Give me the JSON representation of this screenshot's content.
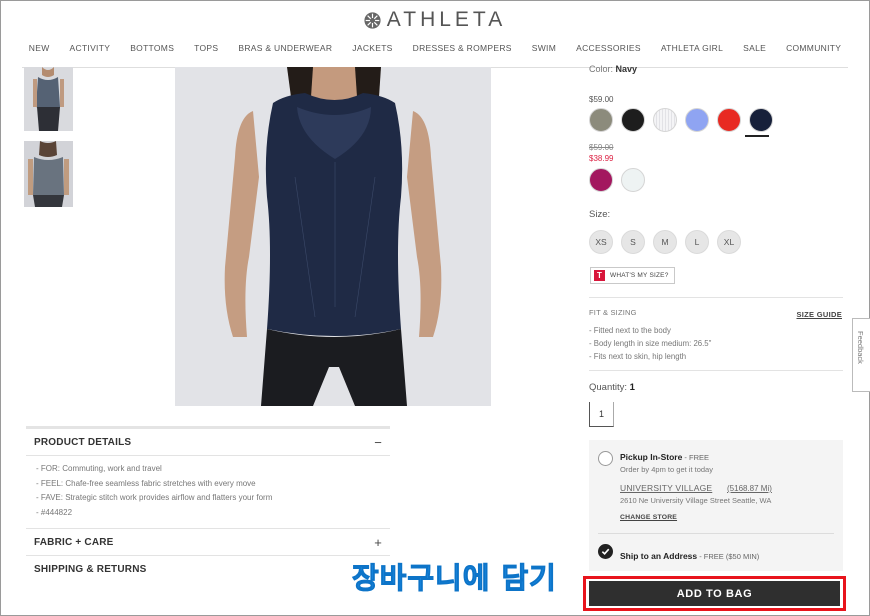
{
  "header": {
    "brand": "ATHLETA",
    "nav": [
      "NEW",
      "ACTIVITY",
      "BOTTOMS",
      "TOPS",
      "BRAS & UNDERWEAR",
      "JACKETS",
      "DRESSES & ROMPERS",
      "SWIM",
      "ACCESSORIES",
      "ATHLETA GIRL",
      "SALE",
      "COMMUNITY"
    ]
  },
  "product": {
    "color_label": "Color:",
    "color_value": "Navy",
    "price_regular": "$59.00",
    "regular_swatches": [
      {
        "name": "olive",
        "hex": "#8c8b7c"
      },
      {
        "name": "black",
        "hex": "#1d1d1d"
      },
      {
        "name": "white-stripe",
        "hex": "#f1f1f3"
      },
      {
        "name": "periwinkle",
        "hex": "#8fa4f2"
      },
      {
        "name": "red",
        "hex": "#e82a22"
      },
      {
        "name": "navy",
        "hex": "#17203a"
      }
    ],
    "price_was": "$59.00",
    "price_sale": "$38.99",
    "sale_swatches": [
      {
        "name": "magenta",
        "hex": "#a3175f"
      },
      {
        "name": "light-mint",
        "hex": "#eef3f3"
      }
    ],
    "size_label": "Size:",
    "sizes": [
      "XS",
      "S",
      "M",
      "L",
      "XL"
    ],
    "whats_my_size": "WHAT'S MY SIZE?",
    "fit_heading": "FIT & SIZING",
    "size_guide": "SIZE GUIDE",
    "fit_notes": [
      "- Fitted next to the body",
      "- Body length in size medium: 26.5\"",
      "- Fits next to skin, hip length"
    ],
    "quantity_label": "Quantity:",
    "quantity_value": "1",
    "quantity_input": "1"
  },
  "fulfillment": {
    "pickup_title": "Pickup In-Store",
    "pickup_tag": " - FREE",
    "pickup_sub": "Order by 4pm to get it today",
    "store_name": "UNIVERSITY VILLAGE",
    "store_distance": "(5168.87 Mi)",
    "store_address": "2610 Ne University Village Street Seattle, WA",
    "change_store": "CHANGE STORE",
    "ship_title": "Ship to an Address",
    "ship_tag": " - FREE ($50 MIN)"
  },
  "details": {
    "product_details_title": "PRODUCT DETAILS",
    "product_details_sign": "−",
    "items": [
      "- FOR: Commuting, work and travel",
      "- FEEL: Chafe-free seamless fabric stretches with every move",
      "- FAVE: Strategic stitch work provides airflow and flatters your form",
      "- #444822"
    ],
    "fabric_title": "FABRIC + CARE",
    "fabric_sign": "+",
    "shipping_title": "SHIPPING & RETURNS"
  },
  "cta": {
    "add_to_bag": "ADD TO BAG"
  },
  "annotation": "장바구니에 담기",
  "feedback": "Feedback",
  "colors": {
    "accent_outline": "#e8141c",
    "annotation": "#2196f3",
    "button": "#2f2f2f"
  }
}
